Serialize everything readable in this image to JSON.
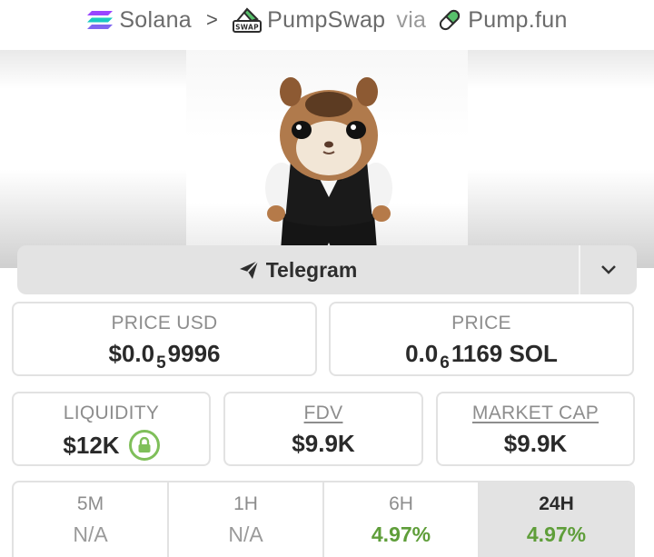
{
  "breadcrumb": {
    "chain": "Solana",
    "separator": ">",
    "dex": "PumpSwap",
    "dex_badge": "SWAP",
    "via": "via",
    "launchpad": "Pump.fun"
  },
  "banner": {
    "image": "hamster-in-tuxedo-mascot"
  },
  "links": {
    "telegram_label": "Telegram",
    "more_icon": "chevron-down-icon"
  },
  "stats": {
    "price_usd": {
      "label": "PRICE USD",
      "prefix": "$0.0",
      "zeros": "5",
      "digits": "9996"
    },
    "price": {
      "label": "PRICE",
      "prefix": "0.0",
      "zeros": "6",
      "digits": "1169 SOL"
    },
    "liquidity": {
      "label": "LIQUIDITY",
      "value": "$12K",
      "icon": "lock-icon"
    },
    "fdv": {
      "label": "FDV",
      "value": "$9.9K"
    },
    "market_cap": {
      "label": "MARKET CAP",
      "value": "$9.9K"
    }
  },
  "timeframes": [
    {
      "label": "5M",
      "change": "N/A"
    },
    {
      "label": "1H",
      "change": "N/A"
    },
    {
      "label": "6H",
      "change": "4.97%"
    },
    {
      "label": "24H",
      "change": "4.97%"
    }
  ],
  "colors": {
    "positive": "#5f9e3a",
    "lock_ring": "#7fbf5a",
    "panel_bg": "#e3e3e3"
  }
}
